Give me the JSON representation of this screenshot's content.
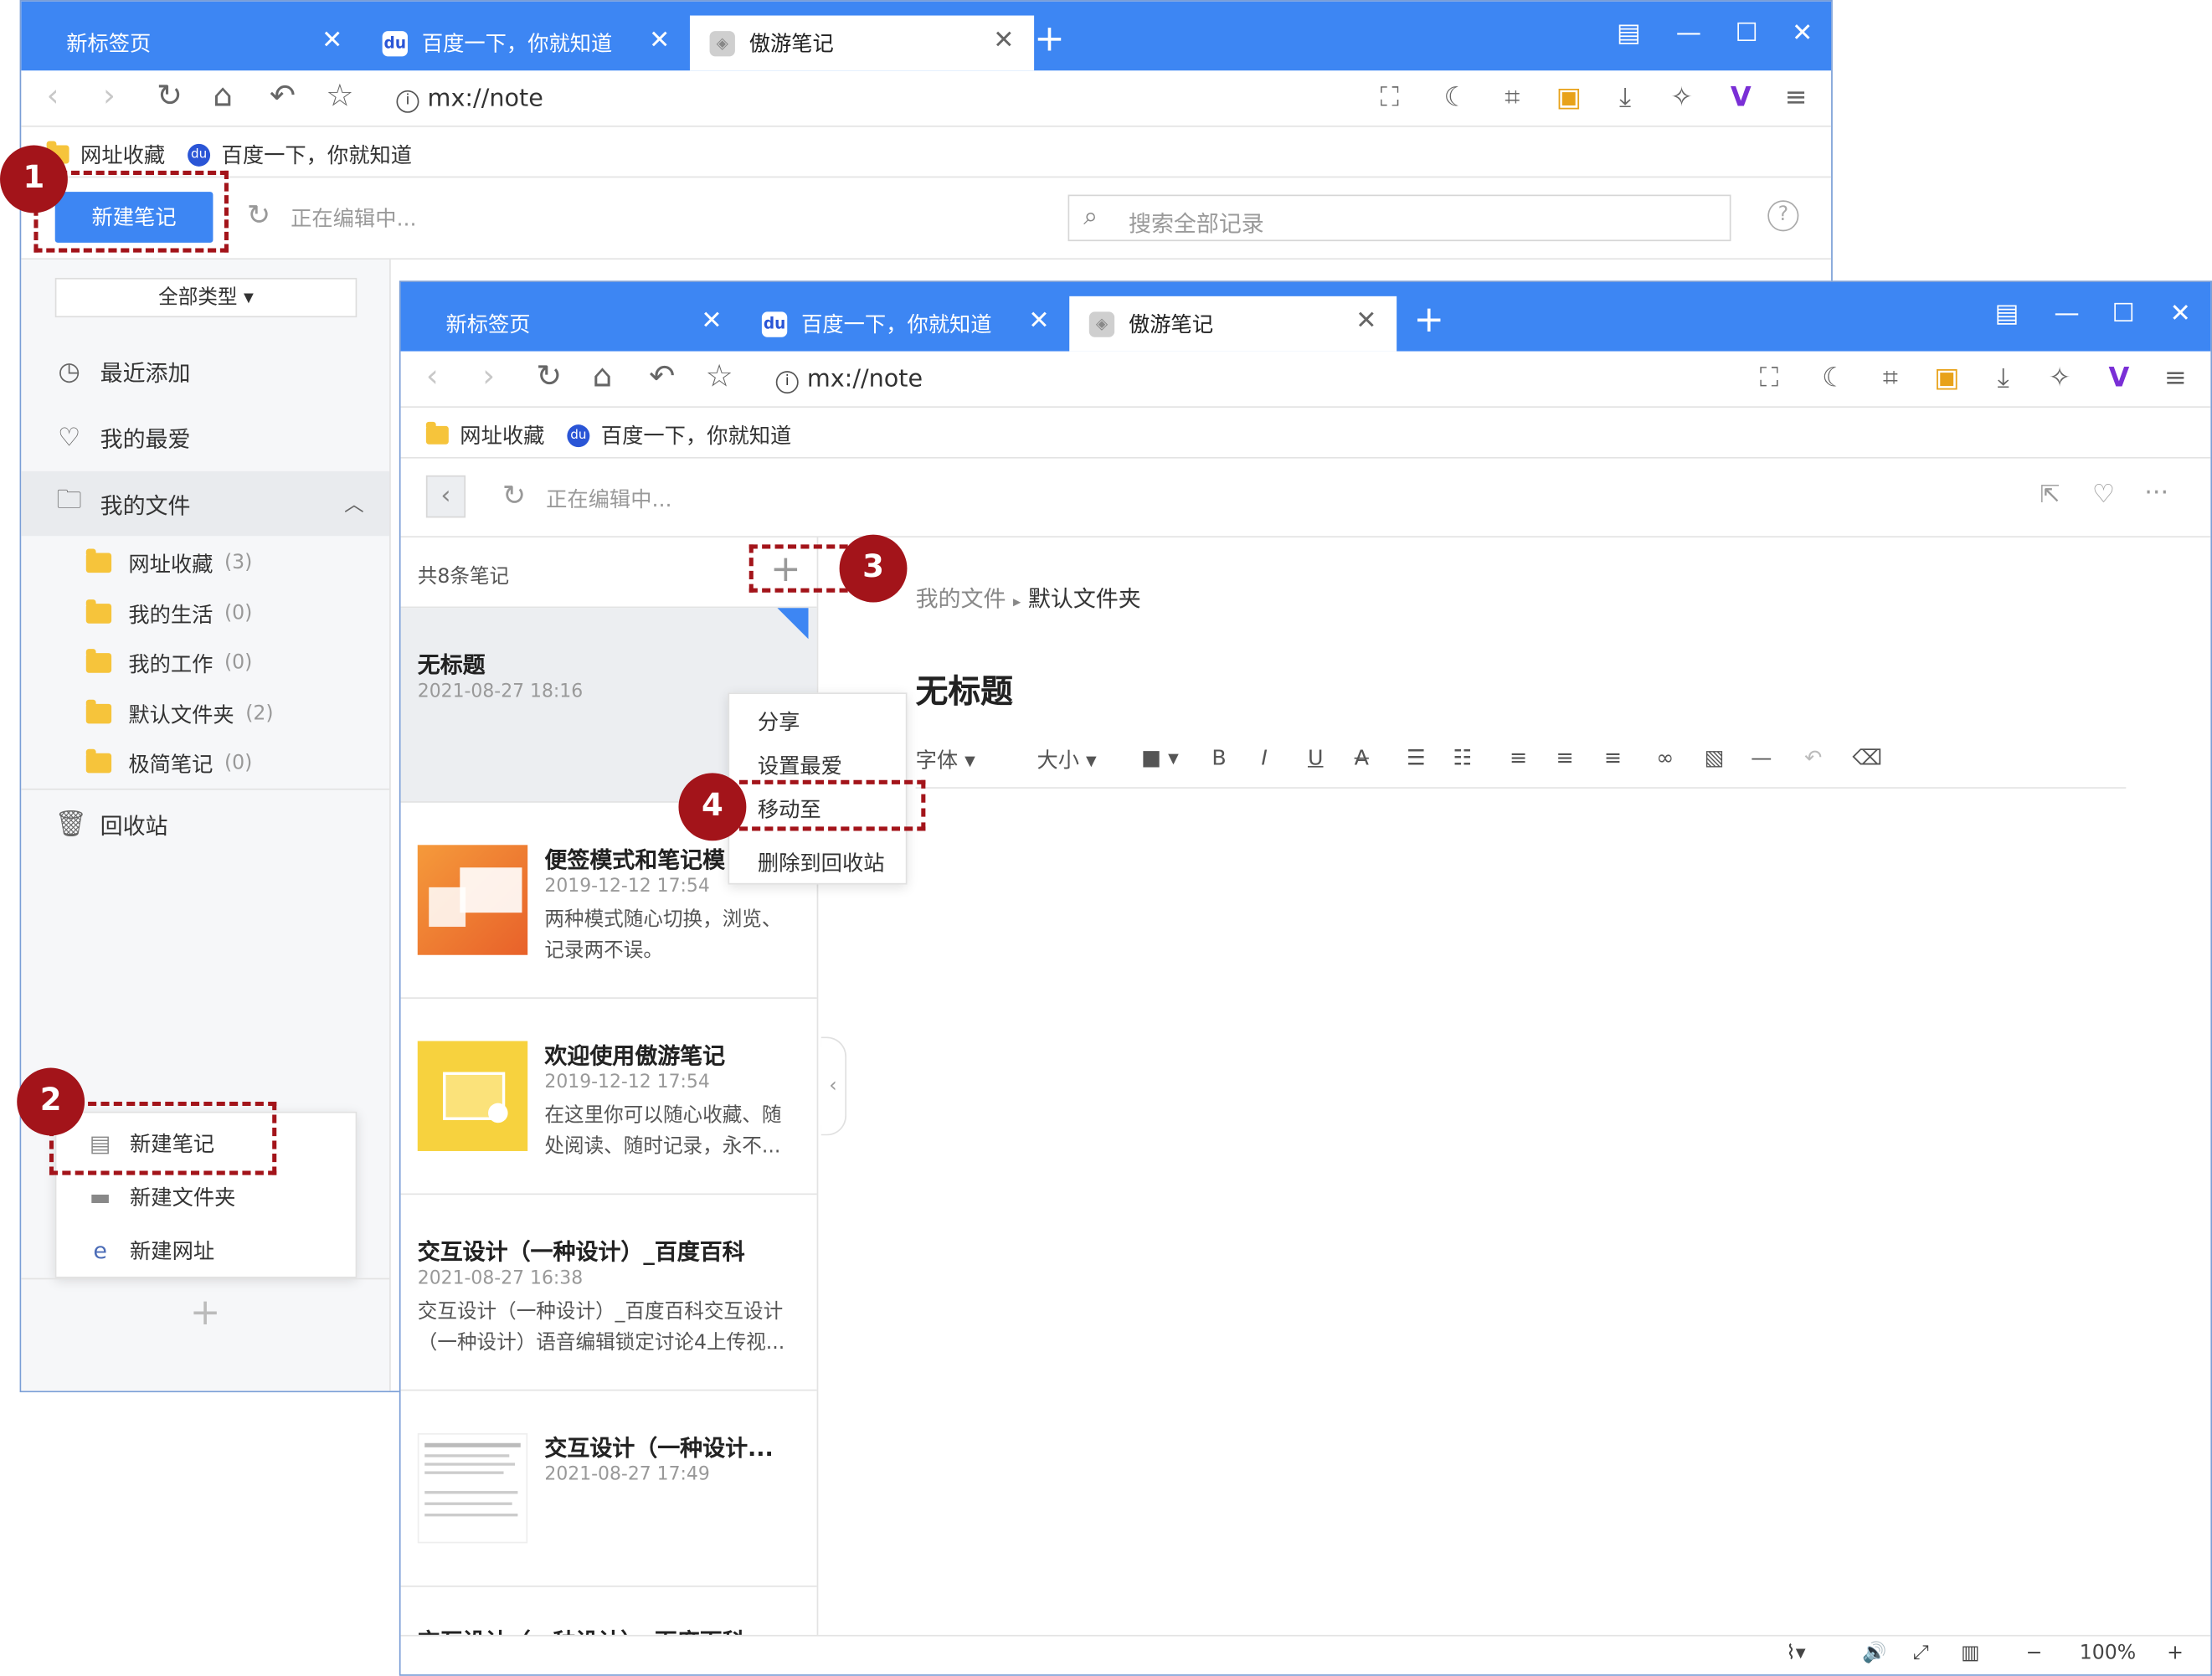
{
  "browser": {
    "tabs": [
      {
        "label": "新标签页"
      },
      {
        "label": "百度一下，你就知道"
      },
      {
        "label": "傲游笔记"
      }
    ],
    "new_tab": "+",
    "window_controls": [
      "layout-icon",
      "minimize-icon",
      "maximize-icon",
      "close-icon"
    ],
    "address": "mx://note",
    "bookmarks": [
      {
        "label": "网址收藏",
        "icon": "folder-icon"
      },
      {
        "label": "百度一下，你就知道",
        "icon": "baidu-icon"
      }
    ]
  },
  "back_window": {
    "new_note_button": "新建笔记",
    "editing_status": "正在编辑中...",
    "search_placeholder": "搜索全部记录",
    "type_filter": "全部类型 ▾",
    "nav": {
      "recent": "最近添加",
      "favorites": "我的最爱",
      "my_files": "我的文件",
      "trash": "回收站"
    },
    "folders": [
      {
        "name": "网址收藏",
        "count": "(3)"
      },
      {
        "name": "我的生活",
        "count": "(0)"
      },
      {
        "name": "我的工作",
        "count": "(0)"
      },
      {
        "name": "默认文件夹",
        "count": "(2)"
      },
      {
        "name": "极简笔记",
        "count": "(0)"
      }
    ],
    "new_menu": [
      "新建笔记",
      "新建文件夹",
      "新建网址"
    ],
    "add_symbol": "+"
  },
  "front_window": {
    "editing_status": "正在编辑中...",
    "list_count": "共8条笔记",
    "add_symbol": "+",
    "notes": [
      {
        "title": "无标题",
        "date": "2021-08-27  18:16",
        "snippet": ""
      },
      {
        "title": "便签模式和笔记模",
        "date": "2019-12-12  17:54",
        "snippet": "两种模式随心切换，浏览、记录两不误。"
      },
      {
        "title": "欢迎使用傲游笔记",
        "date": "2019-12-12  17:54",
        "snippet": "在这里你可以随心收藏、随处阅读、随时记录，永不..."
      },
      {
        "title": "交互设计（一种设计）_百度百科",
        "date": "2021-08-27  16:38",
        "snippet": "交互设计（一种设计）_百度百科交互设计（一种设计）语音编辑锁定讨论4上传视..."
      },
      {
        "title": "交互设计（一种设计...",
        "date": "2021-08-27  17:49",
        "snippet": ""
      },
      {
        "title": "交互设计（一种设计）_百度百科",
        "date": "",
        "snippet": ""
      }
    ],
    "context_menu": [
      "分享",
      "设置最爱",
      "移动至",
      "删除到回收站"
    ],
    "breadcrumb": {
      "parent": "我的文件",
      "current": "默认文件夹"
    },
    "editor_title": "无标题",
    "format_bar": {
      "font": "字体 ▾",
      "size": "大小 ▾",
      "color": "■ ▾",
      "bold": "B",
      "italic": "I",
      "underline": "U",
      "strike": "A"
    },
    "status_zoom": "100%",
    "status_minus": "−",
    "status_plus": "+"
  },
  "callouts": [
    "1",
    "2",
    "3",
    "4"
  ],
  "colors": {
    "accent": "#3d86f3",
    "callout": "#a3141a",
    "folder": "#f6c43b"
  }
}
